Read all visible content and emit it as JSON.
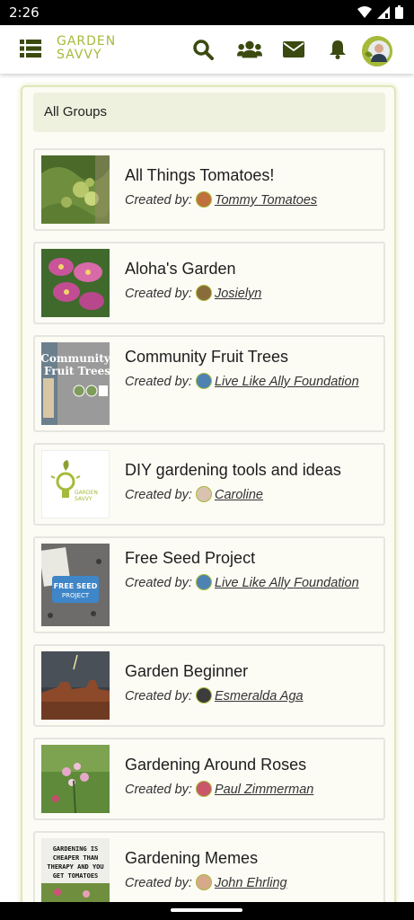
{
  "status_bar": {
    "time": "2:26",
    "icons": [
      "wifi-icon",
      "signal-icon",
      "battery-icon"
    ]
  },
  "header": {
    "logo_line1": "GARDEN",
    "logo_line2": "SAVVY",
    "icons": [
      "menu-grid-icon",
      "search-icon",
      "members-icon",
      "mail-icon",
      "bell-icon"
    ]
  },
  "colors": {
    "brand_green": "#a6ba3a",
    "icon_dark_green": "#3b4a10"
  },
  "panel": {
    "title": "All Groups"
  },
  "groups": [
    {
      "name": "All Things Tomatoes!",
      "created_by_label": "Created by:",
      "creator": "Tommy Tomatoes"
    },
    {
      "name": "Aloha's Garden",
      "created_by_label": "Created by:",
      "creator": "Josielyn"
    },
    {
      "name": "Community Fruit Trees",
      "created_by_label": "Created by:",
      "creator": "Live Like Ally Foundation",
      "thumb_text": "Community Fruit Trees"
    },
    {
      "name": "DIY gardening tools and ideas",
      "created_by_label": "Created by:",
      "creator": "Caroline",
      "thumb_text": "GARDEN SAVVY"
    },
    {
      "name": "Free Seed Project",
      "created_by_label": "Created by:",
      "creator": "Live Like Ally Foundation",
      "thumb_text": "FREE SEED PROJECT"
    },
    {
      "name": "Garden Beginner",
      "created_by_label": "Created by:",
      "creator": "Esmeralda Aga"
    },
    {
      "name": "Gardening Around Roses",
      "created_by_label": "Created by:",
      "creator": "Paul Zimmerman"
    },
    {
      "name": "Gardening Memes",
      "created_by_label": "Created by:",
      "creator": "John Ehrling",
      "thumb_text": "GARDENING IS CHEAPER THAN THERAPY AND YOU GET TOMATOES"
    }
  ]
}
